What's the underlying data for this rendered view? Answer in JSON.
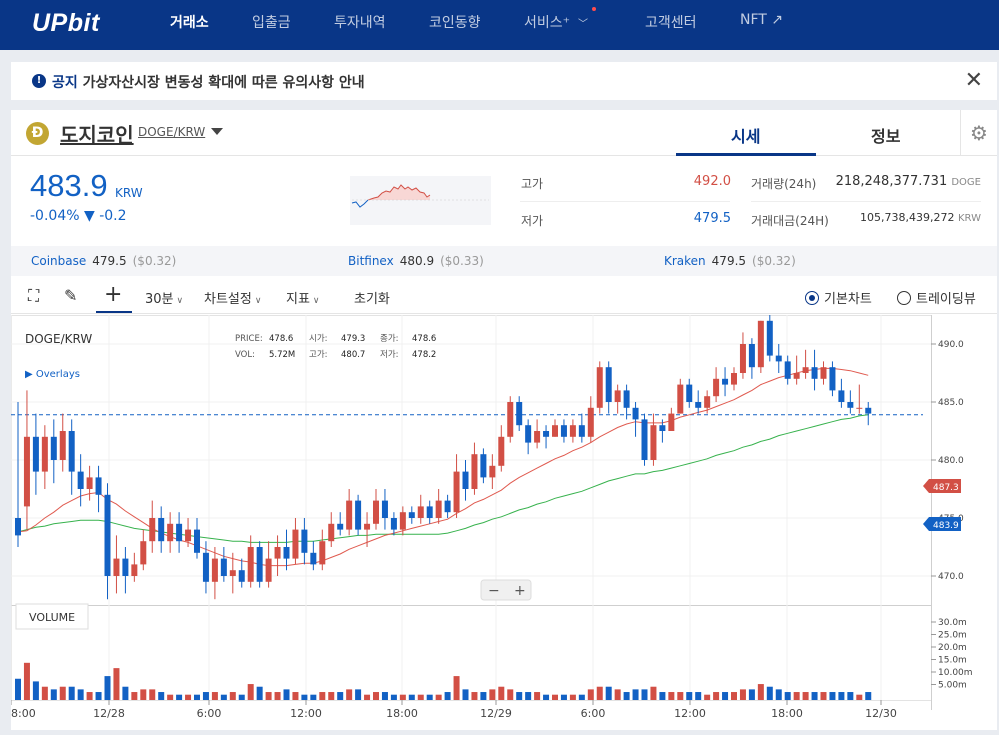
{
  "nav": {
    "logo": "UPbit",
    "items": [
      {
        "label": "거래소",
        "active": true
      },
      {
        "label": "입출금",
        "active": false
      },
      {
        "label": "투자내역",
        "active": false
      },
      {
        "label": "코인동향",
        "active": false
      },
      {
        "label": "서비스⁺",
        "active": false
      },
      {
        "label": "고객센터",
        "active": false
      },
      {
        "label": "NFT ↗",
        "active": false
      }
    ]
  },
  "notice": {
    "label": "공지",
    "text": "가상자산시장 변동성 확대에 따른 유의사항 안내",
    "close": "✕"
  },
  "coin": {
    "symbol_glyph": "Ð",
    "name": "도지코인",
    "pair": "DOGE/KRW",
    "tabs": [
      {
        "label": "시세",
        "active": true
      },
      {
        "label": "정보",
        "active": false
      }
    ],
    "gear": "⚙"
  },
  "price": {
    "current": "483.9",
    "currency": "KRW",
    "change": "-0.04% ▼ -0.2"
  },
  "stats": {
    "high_label": "고가",
    "high": "492.0",
    "low_label": "저가",
    "low": "479.5",
    "volume_label": "거래량(24h)",
    "volume": "218,248,377.731",
    "volume_unit": "DOGE",
    "value_label": "거래대금(24H)",
    "value": "105,738,439,272",
    "value_unit": "KRW"
  },
  "exchanges": [
    {
      "name": "Coinbase",
      "price": "479.5",
      "usd": "($0.32)"
    },
    {
      "name": "Bitfinex",
      "price": "480.9",
      "usd": "($0.33)"
    },
    {
      "name": "Kraken",
      "price": "479.5",
      "usd": "($0.32)"
    }
  ],
  "toolbar": {
    "fullscreen": "⛶",
    "pen": "✎",
    "cross": "+",
    "interval": "30분",
    "settings": "차트설정",
    "indicators": "지표",
    "reset": "초기화",
    "basic_chart": "기본차트",
    "tradingview": "트레이딩뷰"
  },
  "chart_info": {
    "pair": "DOGE/KRW",
    "overlays": "▶ Overlays",
    "price_label": "PRICE:",
    "price": "478.6",
    "open_label": "시가:",
    "open": "479.3",
    "close_label": "종가:",
    "close": "478.6",
    "vol_label": "VOL:",
    "vol": "5.72M",
    "high_label": "고가:",
    "high": "480.7",
    "low_label": "저가:",
    "low": "478.2",
    "volume_title": "VOLUME",
    "zoom_out": "−",
    "zoom_in": "+",
    "tag_ma": "487.3",
    "tag_last": "483.9"
  },
  "colors": {
    "brand": "#093687",
    "up": "#d24f45",
    "down": "#1261c4",
    "ma_fast": "#e05a4f",
    "ma_slow": "#37b24d"
  },
  "chart_data": {
    "type": "candlestick",
    "x_ticks": [
      "8:00",
      "12/28",
      "6:00",
      "12:00",
      "18:00",
      "12/29",
      "6:00",
      "12:00",
      "18:00",
      "12/30"
    ],
    "y_ticks": [
      "490.0",
      "485.0",
      "480.0",
      "475.0",
      "470.0"
    ],
    "volume_ticks": [
      "30.0m",
      "25.0m",
      "20.0m",
      "15.0m",
      "10.00m",
      "5.00m"
    ],
    "ylim": [
      467.5,
      492.5
    ],
    "volume_max": 32,
    "last_price": 483.9,
    "ma_value": 487.3,
    "candles": [
      [
        475,
        473.5,
        485,
        472.5,
        8
      ],
      [
        476,
        482,
        486,
        474,
        14
      ],
      [
        482,
        479,
        484,
        477,
        7
      ],
      [
        479,
        482,
        483,
        477.5,
        5
      ],
      [
        482,
        480,
        483.5,
        478,
        4
      ],
      [
        480,
        482.5,
        484,
        479,
        5
      ],
      [
        482.5,
        479,
        483.5,
        477,
        5
      ],
      [
        479,
        477.5,
        480.5,
        476,
        4
      ],
      [
        477.5,
        478.5,
        479.5,
        476.5,
        3
      ],
      [
        478.5,
        477,
        479.5,
        475.5,
        3
      ],
      [
        477,
        470,
        478,
        468,
        9
      ],
      [
        470,
        471.5,
        473.5,
        468.5,
        12
      ],
      [
        471.5,
        470,
        472.5,
        468.5,
        5
      ],
      [
        470,
        471,
        472,
        469.5,
        3
      ],
      [
        471,
        473,
        474,
        470.5,
        4
      ],
      [
        473,
        475,
        476.5,
        472,
        4
      ],
      [
        475,
        473,
        476,
        472,
        3
      ],
      [
        473,
        474.5,
        475.5,
        472,
        2
      ],
      [
        474.5,
        473,
        475.5,
        472,
        2
      ],
      [
        473,
        474,
        475,
        472.5,
        2
      ],
      [
        474,
        472,
        475,
        471.5,
        2
      ],
      [
        472,
        469.5,
        473,
        468.5,
        3
      ],
      [
        469.5,
        471.5,
        472.5,
        468,
        3
      ],
      [
        471.5,
        470,
        472.5,
        469.5,
        2
      ],
      [
        470,
        470.5,
        472,
        468.5,
        3
      ],
      [
        470.5,
        469.5,
        471.5,
        469,
        2
      ],
      [
        469.5,
        472.5,
        473.5,
        469,
        6
      ],
      [
        472.5,
        469.5,
        473,
        469,
        5
      ],
      [
        469.5,
        471.5,
        473,
        469,
        3
      ],
      [
        471.5,
        472.5,
        473.5,
        470,
        3
      ],
      [
        472.5,
        471.5,
        474,
        470.5,
        4
      ],
      [
        471.5,
        474,
        475,
        471,
        3
      ],
      [
        474,
        472,
        475,
        471,
        2
      ],
      [
        472,
        471,
        473,
        470.5,
        2
      ],
      [
        471,
        473,
        474,
        470.5,
        3
      ],
      [
        473,
        474.5,
        475.5,
        472.5,
        3
      ],
      [
        474.5,
        474,
        475.5,
        473.5,
        3
      ],
      [
        474,
        476.5,
        477.5,
        473.5,
        4
      ],
      [
        476.5,
        474,
        477,
        473.5,
        4
      ],
      [
        474,
        474.5,
        475.5,
        472.5,
        2
      ],
      [
        474.5,
        476.5,
        477.5,
        474,
        3
      ],
      [
        476.5,
        475,
        477.5,
        474,
        3
      ],
      [
        475,
        474,
        475.5,
        473.5,
        2
      ],
      [
        474,
        475.5,
        476,
        473.5,
        2
      ],
      [
        475.5,
        475,
        476,
        474.5,
        2
      ],
      [
        475,
        476,
        477,
        474.5,
        2
      ],
      [
        476,
        475,
        476.5,
        474.5,
        2
      ],
      [
        475,
        476.5,
        477.5,
        474.5,
        2
      ],
      [
        476.5,
        475.5,
        477,
        475,
        3
      ],
      [
        475.5,
        479,
        480.5,
        475,
        9
      ],
      [
        479,
        477.5,
        480,
        476.5,
        4
      ],
      [
        477.5,
        480.5,
        481.5,
        477,
        3
      ],
      [
        480.5,
        478.5,
        481,
        478,
        3
      ],
      [
        478.5,
        479.5,
        480.5,
        477.5,
        4
      ],
      [
        479.5,
        482,
        483,
        479,
        5
      ],
      [
        482,
        485,
        485.5,
        481.5,
        4
      ],
      [
        485,
        483,
        485.5,
        482.5,
        3
      ],
      [
        483,
        481.5,
        483.5,
        480.5,
        3
      ],
      [
        481.5,
        482.5,
        483.5,
        481,
        3
      ],
      [
        482.5,
        482,
        483,
        481,
        2
      ],
      [
        482,
        483,
        483.5,
        482,
        2
      ],
      [
        483,
        482,
        483.5,
        481.5,
        2
      ],
      [
        482,
        483,
        483.5,
        481.5,
        2
      ],
      [
        483,
        482,
        484,
        481.5,
        2
      ],
      [
        482,
        484.5,
        485.5,
        481.5,
        4
      ],
      [
        484.5,
        488,
        488.5,
        484,
        5
      ],
      [
        488,
        485,
        488.5,
        484,
        5
      ],
      [
        485,
        486,
        486.5,
        484,
        4
      ],
      [
        486,
        484.5,
        486.5,
        483.5,
        3
      ],
      [
        484.5,
        483.5,
        485,
        482,
        4
      ],
      [
        483.5,
        480,
        484,
        479.5,
        4
      ],
      [
        480,
        483,
        484,
        479.5,
        5
      ],
      [
        483,
        482.5,
        483.5,
        481.5,
        3
      ],
      [
        482.5,
        484,
        484.5,
        482.5,
        3
      ],
      [
        484,
        486.5,
        487,
        484,
        3
      ],
      [
        486.5,
        485,
        487,
        484.5,
        3
      ],
      [
        485,
        484.5,
        486,
        484,
        3
      ],
      [
        484.5,
        485.5,
        486,
        484,
        2
      ],
      [
        485.5,
        487,
        488,
        485,
        3
      ],
      [
        487,
        486.5,
        488,
        485.5,
        3
      ],
      [
        486.5,
        487.5,
        488,
        486,
        3
      ],
      [
        487.5,
        490,
        491,
        487,
        4
      ],
      [
        490,
        488,
        490.5,
        487,
        4
      ],
      [
        488,
        492,
        492,
        487.5,
        6
      ],
      [
        492,
        489,
        492.5,
        488.5,
        5
      ],
      [
        489,
        488.5,
        490,
        487.5,
        4
      ],
      [
        488.5,
        487,
        489,
        486.5,
        3
      ],
      [
        487,
        487.5,
        489,
        486.5,
        3
      ],
      [
        487.5,
        488,
        489.5,
        487,
        3
      ],
      [
        488,
        487,
        489.5,
        486,
        3
      ],
      [
        487,
        488,
        488.5,
        486.5,
        3
      ],
      [
        488,
        486,
        488.5,
        485.5,
        3
      ],
      [
        486,
        485,
        487,
        484.5,
        3
      ],
      [
        485,
        484.5,
        486,
        484,
        3
      ],
      [
        484.5,
        484.5,
        486.5,
        484,
        2
      ],
      [
        484.5,
        484,
        485,
        483,
        3
      ]
    ],
    "ma_fast": [
      473.8,
      473.9,
      474.4,
      475.0,
      475.5,
      476.1,
      476.5,
      476.9,
      477.1,
      477.2,
      476.6,
      476.2,
      475.6,
      475.1,
      474.6,
      474.1,
      473.7,
      473.4,
      473.1,
      472.9,
      472.6,
      472.3,
      472.0,
      471.7,
      471.5,
      471.3,
      471.2,
      471.0,
      470.9,
      470.9,
      470.9,
      471.0,
      471.1,
      471.1,
      471.3,
      471.6,
      471.9,
      472.3,
      472.6,
      472.9,
      473.2,
      473.5,
      473.7,
      473.9,
      474.1,
      474.3,
      474.5,
      474.7,
      474.9,
      475.4,
      475.8,
      476.3,
      476.6,
      477.0,
      477.4,
      478.0,
      478.5,
      478.9,
      479.3,
      479.7,
      480.1,
      480.4,
      480.8,
      481.1,
      481.5,
      482.0,
      482.4,
      482.8,
      483.1,
      483.3,
      483.2,
      483.2,
      483.2,
      483.4,
      483.7,
      483.9,
      484.1,
      484.3,
      484.6,
      484.9,
      485.2,
      485.6,
      486.0,
      486.5,
      486.8,
      487.1,
      487.3,
      487.5,
      487.7,
      487.8,
      487.9,
      487.9,
      487.8,
      487.7,
      487.5,
      487.3
    ],
    "ma_slow": [
      473.8,
      474.0,
      474.2,
      474.3,
      474.5,
      474.6,
      474.7,
      474.8,
      474.8,
      474.8,
      474.7,
      474.5,
      474.3,
      474.1,
      474.0,
      473.9,
      473.8,
      473.7,
      473.6,
      473.5,
      473.4,
      473.3,
      473.2,
      473.1,
      473.0,
      473.0,
      472.9,
      472.9,
      472.9,
      472.9,
      472.9,
      473.0,
      473.0,
      473.0,
      473.1,
      473.2,
      473.3,
      473.4,
      473.5,
      473.5,
      473.6,
      473.6,
      473.6,
      473.6,
      473.6,
      473.6,
      473.6,
      473.6,
      473.7,
      473.9,
      474.1,
      474.4,
      474.6,
      474.9,
      475.1,
      475.4,
      475.7,
      475.9,
      476.2,
      476.4,
      476.7,
      476.9,
      477.1,
      477.3,
      477.6,
      477.9,
      478.2,
      478.4,
      478.6,
      478.8,
      478.8,
      479.0,
      479.1,
      479.3,
      479.5,
      479.7,
      479.9,
      480.1,
      480.4,
      480.6,
      480.8,
      481.1,
      481.3,
      481.6,
      481.8,
      482.1,
      482.3,
      482.5,
      482.7,
      482.9,
      483.1,
      483.3,
      483.5,
      483.6,
      483.8,
      483.9
    ]
  }
}
